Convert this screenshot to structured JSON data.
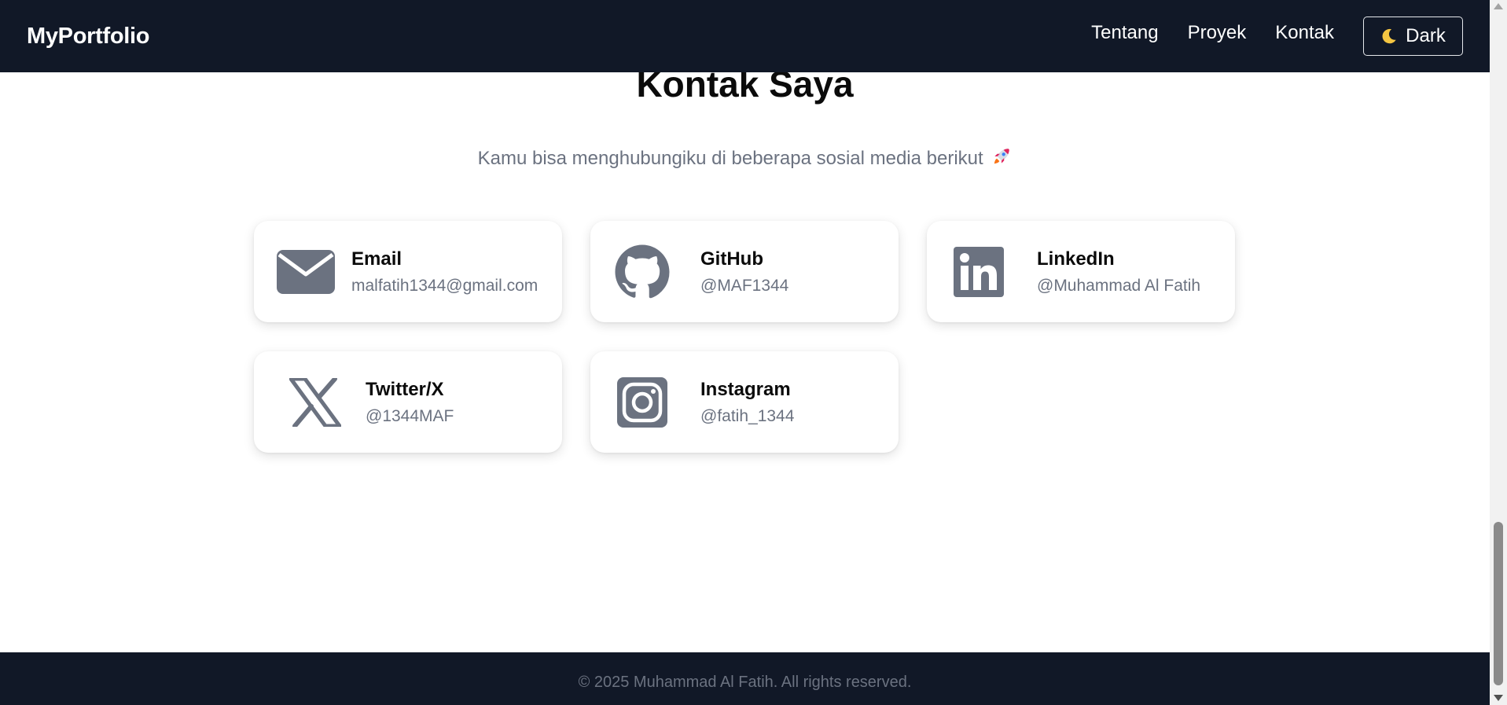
{
  "navbar": {
    "brand": "MyPortfolio",
    "links": [
      {
        "label": "Tentang"
      },
      {
        "label": "Proyek"
      },
      {
        "label": "Kontak"
      }
    ],
    "theme_toggle": {
      "label": "Dark",
      "icon": "moon-icon"
    }
  },
  "contact": {
    "title": "Kontak Saya",
    "subtitle": "Kamu bisa menghubungiku di beberapa sosial media berikut",
    "subtitle_icon": "rocket-icon",
    "cards": [
      {
        "name": "Email",
        "handle": "malfatih1344@gmail.com",
        "icon": "email-icon"
      },
      {
        "name": "GitHub",
        "handle": "@MAF1344",
        "icon": "github-icon"
      },
      {
        "name": "LinkedIn",
        "handle": "@Muhammad Al Fatih",
        "icon": "linkedin-icon"
      },
      {
        "name": "Twitter/X",
        "handle": "@1344MAF",
        "icon": "x-icon"
      },
      {
        "name": "Instagram",
        "handle": "@fatih_1344",
        "icon": "instagram-icon"
      }
    ]
  },
  "footer": {
    "text": "© 2025 Muhammad Al Fatih. All rights reserved."
  },
  "colors": {
    "navbar_bg": "#111827",
    "icon_gray": "#6b7280",
    "muted_text": "#6b7280"
  }
}
